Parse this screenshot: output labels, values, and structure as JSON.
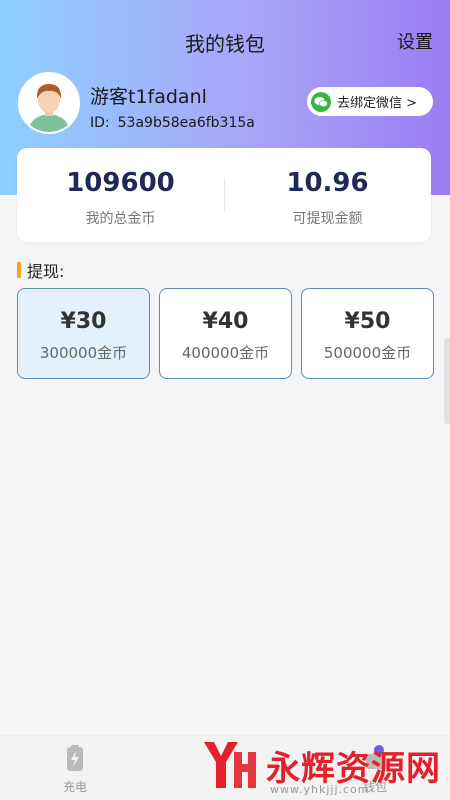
{
  "nav": {
    "title": "我的钱包",
    "settings_label": "设置"
  },
  "user": {
    "name": "游客t1fadanl",
    "id_label": "ID:",
    "id_value": "53a9b58ea6fb315a"
  },
  "wechat": {
    "label": "去绑定微信 >"
  },
  "stats": {
    "total_coins": "109600",
    "total_coins_label": "我的总金币",
    "withdrawable": "10.96",
    "withdrawable_label": "可提现金额"
  },
  "withdraw": {
    "section_title": "提现:",
    "options": [
      {
        "price": "¥30",
        "coins": "300000金币",
        "selected": true
      },
      {
        "price": "¥40",
        "coins": "400000金币",
        "selected": false
      },
      {
        "price": "¥50",
        "coins": "500000金币",
        "selected": false
      }
    ]
  },
  "tabbar": {
    "charge_label": "充电",
    "wallet_label": "钱包"
  },
  "watermark": {
    "text": "永辉资源网",
    "url": "www.yhkjjj.com"
  },
  "colors": {
    "accent": "#1e2a55",
    "gradient_start": "#8ecfff",
    "gradient_end": "#9a7df2",
    "section_bar": "#f3a32a",
    "wechat": "#3bb44a"
  }
}
